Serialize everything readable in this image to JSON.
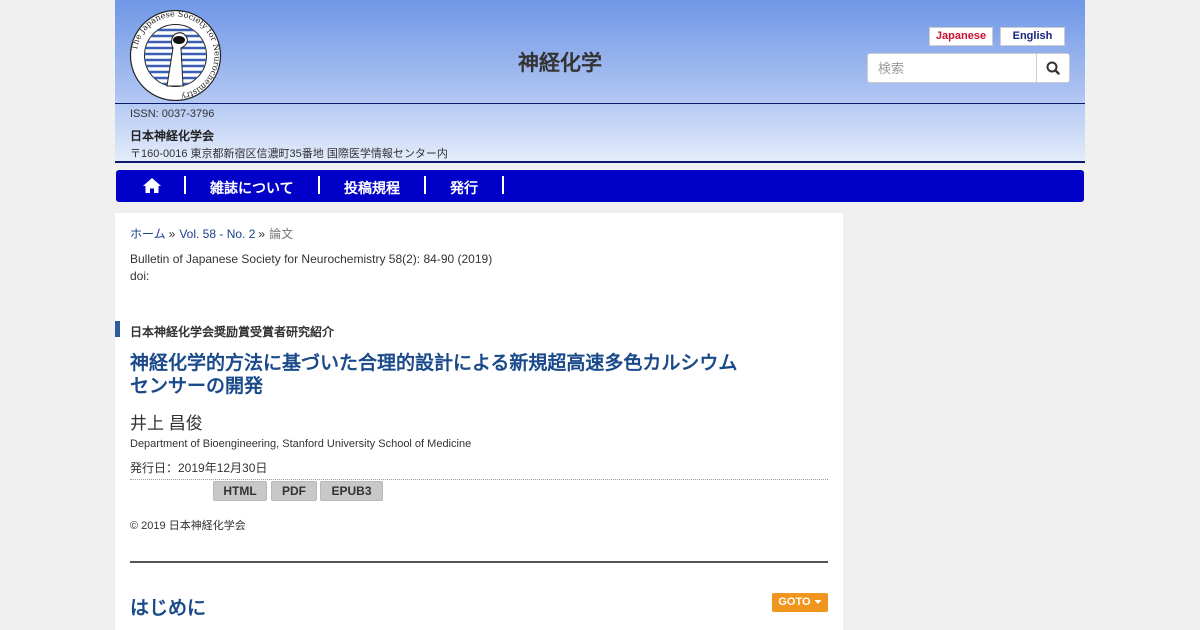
{
  "header": {
    "site_title": "神経化学",
    "logo_text": "The Japanese Society for Neurochemistry",
    "lang_japanese": "Japanese",
    "lang_english": "English",
    "search_placeholder": "検索",
    "issn": "ISSN: 0037-3796",
    "society": "日本神経化学会",
    "address": "〒160-0016 東京都新宿区信濃町35番地 国際医学情報センター内"
  },
  "nav": {
    "home_icon": "home-icon",
    "items": [
      "雑誌について",
      "投稿規程",
      "発行"
    ]
  },
  "breadcrumb": {
    "home": "ホーム",
    "sep": "»",
    "volume": "Vol. 58 - No. 2",
    "current": "論文"
  },
  "article": {
    "bulletin": "Bulletin of Japanese Society for Neurochemistry 58(2): 84-90 (2019)",
    "doi": "doi:",
    "category": "日本神経化学会奨励賞受賞者研究紹介",
    "title_line1": "神経化学的方法に基づいた合理的設計による新規超高速多色カルシウム",
    "title_line2": "センサーの開発",
    "author": "井上 昌俊",
    "affiliation": "Department of Bioengineering, Stanford University School of Medicine",
    "pub_date": "発行日：2019年12月30日",
    "formats": [
      "HTML",
      "PDF",
      "EPUB3"
    ],
    "copyright": "© 2019 日本神経化学会"
  },
  "section": {
    "title": "はじめに",
    "goto_label": "GOTO"
  },
  "colors": {
    "nav_bg": "#0000c8",
    "title_blue": "#1a4a8a",
    "goto_orange": "#f0961e",
    "lang_ja_red": "#c8102e"
  }
}
